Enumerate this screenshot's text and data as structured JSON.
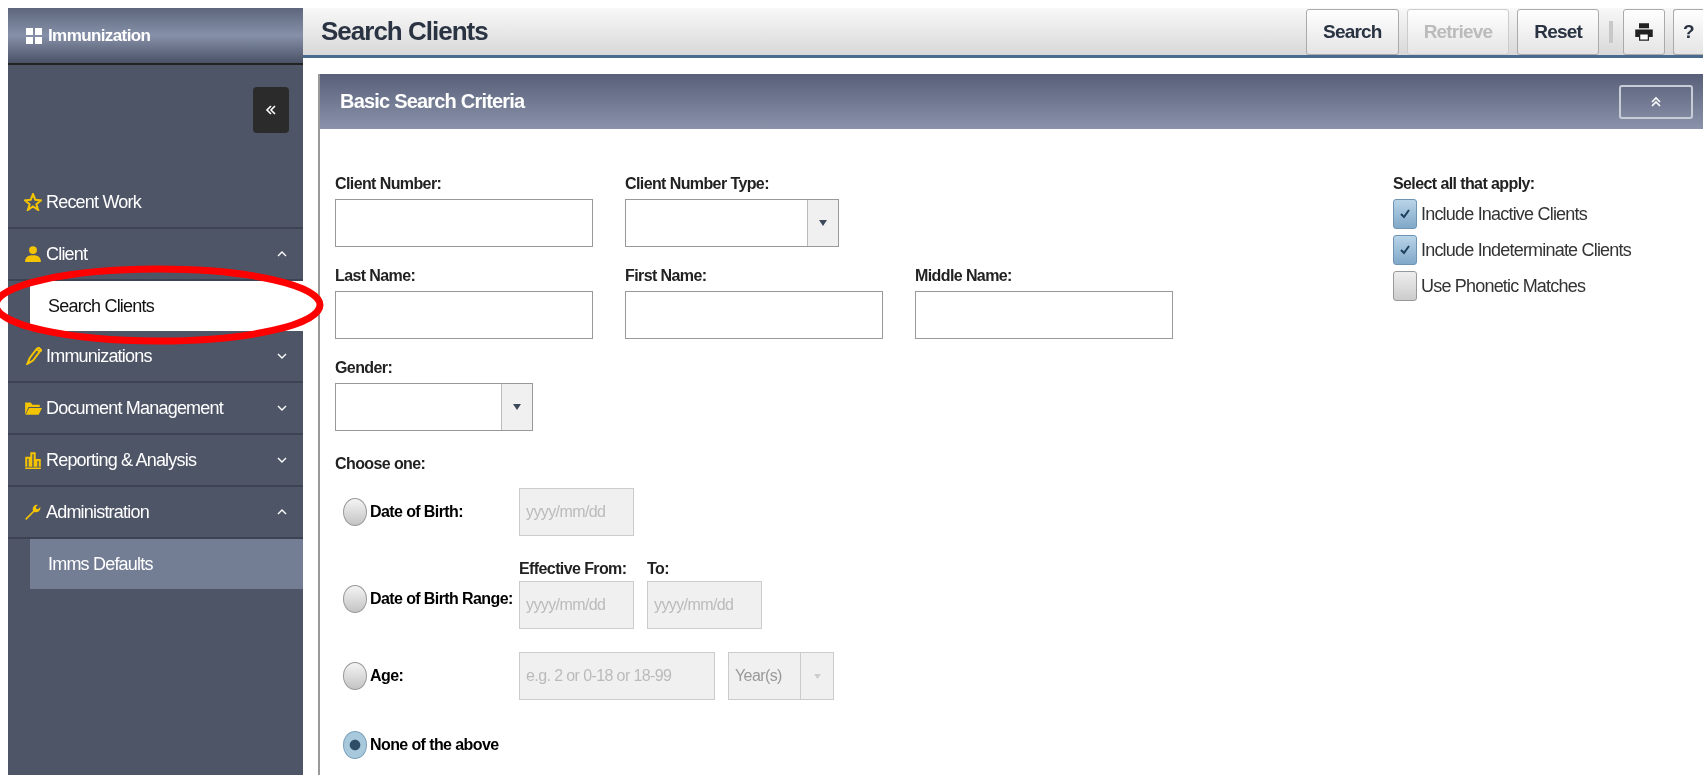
{
  "app_title": "Immunization",
  "page_title": "Search Clients",
  "toolbar": [
    {
      "label": "Search",
      "disabled": false
    },
    {
      "label": "Retrieve",
      "disabled": true
    },
    {
      "label": "Reset",
      "disabled": false
    }
  ],
  "help_label": "?",
  "sidebar": {
    "items": [
      {
        "label": "Recent Work"
      },
      {
        "label": "Client",
        "expanded": true,
        "children": [
          {
            "label": "Search Clients",
            "selected": true
          }
        ]
      },
      {
        "label": "Immunizations",
        "expanded": false
      },
      {
        "label": "Document Management",
        "expanded": false
      },
      {
        "label": "Reporting & Analysis",
        "expanded": false
      },
      {
        "label": "Administration",
        "expanded": true,
        "children": [
          {
            "label": "Imms Defaults",
            "selected": false
          }
        ]
      }
    ]
  },
  "panel_title": "Basic Search Criteria",
  "fields_row1": [
    {
      "label": "Client Number:",
      "kind": "text"
    },
    {
      "label": "Client Number Type:",
      "kind": "select"
    }
  ],
  "fields_row2": [
    {
      "label": "Last Name:",
      "kind": "text"
    },
    {
      "label": "First Name:",
      "kind": "text"
    },
    {
      "label": "Middle Name:",
      "kind": "text"
    }
  ],
  "gender": {
    "label": "Gender:",
    "kind": "select"
  },
  "choose_label": "Choose one:",
  "choices": [
    {
      "label": "Date of Birth:",
      "selected": false,
      "kind": "date"
    },
    {
      "label": "Date of Birth Range:",
      "selected": false,
      "kind": "range"
    },
    {
      "label": "Age:",
      "selected": false,
      "kind": "age"
    },
    {
      "label": "None of the above",
      "selected": true,
      "kind": "none"
    }
  ],
  "date_placeholder": "yyyy/mm/dd",
  "range_from_label": "Effective From:",
  "range_to_label": "To:",
  "range_from_placeholder": "yyyy/mm/dd",
  "range_to_placeholder": "yyyy/mm/dd",
  "age_placeholder": "e.g. 2 or 0-18 or 18-99",
  "age_unit": "Year(s)",
  "options_label": "Select all that apply:",
  "options": [
    {
      "label": "Include Inactive Clients",
      "checked": true
    },
    {
      "label": "Include Indeterminate Clients",
      "checked": true
    },
    {
      "label": "Use Phonetic Matches",
      "checked": false
    }
  ],
  "annotation": {
    "kind": "ellipse"
  }
}
